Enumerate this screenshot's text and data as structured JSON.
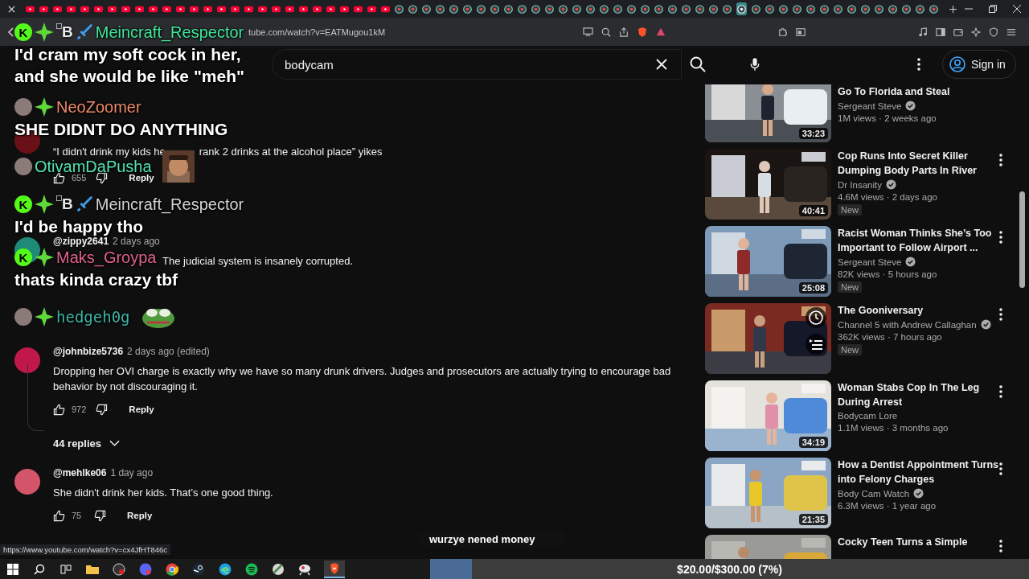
{
  "tabs": [
    {
      "kind": "youtube",
      "selected": false
    },
    {
      "kind": "youtube",
      "selected": false
    },
    {
      "kind": "youtube",
      "selected": false
    },
    {
      "kind": "youtube",
      "selected": false
    },
    {
      "kind": "youtube",
      "selected": false
    },
    {
      "kind": "youtube",
      "selected": false
    },
    {
      "kind": "youtube",
      "selected": false
    },
    {
      "kind": "youtube",
      "selected": false
    },
    {
      "kind": "youtube",
      "selected": false
    },
    {
      "kind": "youtube",
      "selected": false
    },
    {
      "kind": "youtube",
      "selected": false
    },
    {
      "kind": "youtube",
      "selected": false
    },
    {
      "kind": "youtube",
      "selected": false
    },
    {
      "kind": "youtube",
      "selected": false
    },
    {
      "kind": "youtube",
      "selected": false
    },
    {
      "kind": "youtube",
      "selected": false
    },
    {
      "kind": "youtube",
      "selected": false
    },
    {
      "kind": "youtube",
      "selected": false
    },
    {
      "kind": "youtube",
      "selected": false
    },
    {
      "kind": "youtube",
      "selected": false
    },
    {
      "kind": "youtube",
      "selected": false
    },
    {
      "kind": "youtube",
      "selected": false
    },
    {
      "kind": "youtube",
      "selected": false
    },
    {
      "kind": "youtube",
      "selected": false
    },
    {
      "kind": "youtube",
      "selected": false
    },
    {
      "kind": "youtube",
      "selected": false
    },
    {
      "kind": "youtube",
      "selected": false
    },
    {
      "kind": "site",
      "selected": false
    },
    {
      "kind": "site",
      "selected": false
    },
    {
      "kind": "site",
      "selected": false
    },
    {
      "kind": "site",
      "selected": false
    },
    {
      "kind": "site",
      "selected": false
    },
    {
      "kind": "site",
      "selected": false
    },
    {
      "kind": "site",
      "selected": false
    },
    {
      "kind": "site",
      "selected": false
    },
    {
      "kind": "site",
      "selected": false
    },
    {
      "kind": "site",
      "selected": false
    },
    {
      "kind": "site",
      "selected": false
    },
    {
      "kind": "site",
      "selected": false
    },
    {
      "kind": "site",
      "selected": false
    },
    {
      "kind": "site",
      "selected": false
    },
    {
      "kind": "site",
      "selected": false
    },
    {
      "kind": "site",
      "selected": false
    },
    {
      "kind": "site",
      "selected": false
    },
    {
      "kind": "site",
      "selected": false
    },
    {
      "kind": "site",
      "selected": false
    },
    {
      "kind": "site",
      "selected": false
    },
    {
      "kind": "site",
      "selected": false
    },
    {
      "kind": "site",
      "selected": false
    },
    {
      "kind": "site",
      "selected": false
    },
    {
      "kind": "site",
      "selected": false
    },
    {
      "kind": "site",
      "selected": false
    },
    {
      "kind": "site",
      "selected": true
    },
    {
      "kind": "site",
      "selected": false
    },
    {
      "kind": "site",
      "selected": false
    },
    {
      "kind": "site",
      "selected": false
    },
    {
      "kind": "site",
      "selected": false
    },
    {
      "kind": "site",
      "selected": false
    },
    {
      "kind": "site",
      "selected": false
    },
    {
      "kind": "site",
      "selected": false
    },
    {
      "kind": "site",
      "selected": false
    },
    {
      "kind": "site",
      "selected": false
    },
    {
      "kind": "site",
      "selected": false
    },
    {
      "kind": "site",
      "selected": false
    },
    {
      "kind": "site",
      "selected": false
    },
    {
      "kind": "site",
      "selected": false
    },
    {
      "kind": "site",
      "selected": false
    }
  ],
  "browser": {
    "url": "tube.com/watch?v=EATMugou1kM",
    "status_url": "https://www.youtube.com/watch?v=cx4JfHT846c"
  },
  "search": {
    "value": "bodycam"
  },
  "sign_in": "Sign in",
  "comments": [
    {
      "color": "#6a1018",
      "text_parts": [
        "“I didn't drink my kids he",
        "rank 2 drinks at the alcohol place” yikes"
      ],
      "likes": "655",
      "reply": "Reply"
    },
    {
      "color": "#1f8a78",
      "author": "@zippy2641",
      "time": "2 days ago",
      "text_parts": [
        "The judicial system is insanely corrupted."
      ]
    },
    {
      "color": "#c0184a",
      "author": "@johnbize5736",
      "time": "2 days ago (edited)",
      "text_parts": [
        "Dropping her OVI charge is exactly why we have so many drunk drivers. Judges and prosecutors are actually trying to encourage bad behavior by not discouraging it."
      ],
      "likes": "972",
      "reply": "Reply",
      "replies": "44 replies"
    },
    {
      "color": "#d2556a",
      "author": "@mehlke06",
      "time": "1 day ago",
      "text_parts": [
        "She didn't drink her kids. That’s one good thing."
      ],
      "likes": "75",
      "reply": "Reply"
    }
  ],
  "sidebar_videos": [
    {
      "title": "Go To Florida and Steal",
      "channel": "Sergeant Steve",
      "verified": true,
      "meta": "1M views · 2 weeks ago",
      "duration": "33:23",
      "menu": false
    },
    {
      "title": "Cop Runs Into Secret Killer Dumping Body Parts In River",
      "channel": "Dr Insanity",
      "verified": true,
      "meta": "4.6M views · 2 days ago",
      "badge": "New",
      "duration": "40:41",
      "menu": true
    },
    {
      "title": "Racist Woman Thinks She’s Too Important to Follow Airport ...",
      "channel": "Sergeant Steve",
      "verified": true,
      "meta": "82K views · 5 hours ago",
      "badge": "New",
      "duration": "25:08",
      "menu": true
    },
    {
      "title": "The Gooniversary",
      "channel": "Channel 5 with Andrew Callaghan",
      "verified": true,
      "meta": "362K views · 7 hours ago",
      "badge": "New",
      "hover": true,
      "menu": true
    },
    {
      "title": "Woman Stabs Cop In The Leg During Arrest",
      "channel": "Bodycam Lore",
      "verified": false,
      "meta": "1.1M views · 3 months ago",
      "duration": "34:19",
      "menu": true
    },
    {
      "title": "How a Dentist Appointment Turns into Felony Charges",
      "channel": "Body Cam Watch",
      "verified": true,
      "meta": "6.3M views · 1 year ago",
      "duration": "21:35",
      "menu": true
    },
    {
      "title": "Cocky Teen Turns a Simple",
      "menu": true
    }
  ],
  "chat": [
    {
      "name": "Meincraft_Respector",
      "color": "#3ee89a",
      "badges": [
        {
          "kind": "kick",
          "text": "K"
        },
        {
          "kind": "diamond"
        },
        {
          "kind": "alt",
          "text": "B"
        },
        {
          "kind": "sword"
        }
      ],
      "message": "I'd cram my soft cock in her, and she would be like \"meh\""
    },
    {
      "name": "NeoZoomer",
      "color": "#f0896a",
      "badges": [
        {
          "kind": "avatar"
        },
        {
          "kind": "diamond"
        }
      ],
      "message": "SHE DIDNT DO ANYTHING"
    },
    {
      "name": "OtivamDaPusha",
      "color": "#52e3b6",
      "badges": [
        {
          "kind": "avatar"
        }
      ],
      "kind": "picture-emote"
    },
    {
      "name": "Meincraft_Respector",
      "color": "#d4d4d4",
      "badges": [
        {
          "kind": "kick",
          "text": "K"
        },
        {
          "kind": "diamond"
        },
        {
          "kind": "alt",
          "text": "B"
        },
        {
          "kind": "sword"
        }
      ],
      "message": "I'd be happy tho"
    },
    {
      "name": "Maks_Groypa",
      "color": "#e2628c",
      "badges": [
        {
          "kind": "kick",
          "text": "K"
        },
        {
          "kind": "diamond"
        }
      ],
      "message": "thats kinda crazy tbf"
    },
    {
      "name": "hedgeh0g",
      "color": "#3bb5a4",
      "badges": [
        {
          "kind": "avatar"
        },
        {
          "kind": "diamond"
        }
      ],
      "kind": "frog-emote"
    }
  ],
  "goal": {
    "title": "wurzye nened money",
    "amount": "$20.00/$300.00 (7%)",
    "level": 0.07
  },
  "taskbar": [
    {
      "kind": "windows",
      "selected": false
    },
    {
      "kind": "search",
      "selected": false
    },
    {
      "kind": "taskview",
      "selected": false
    },
    {
      "kind": "folder",
      "selected": false
    },
    {
      "kind": "record",
      "selected": false
    },
    {
      "kind": "chat",
      "selected": false
    },
    {
      "kind": "chrome",
      "selected": false
    },
    {
      "kind": "steam",
      "selected": false
    },
    {
      "kind": "edge",
      "selected": false
    },
    {
      "kind": "spotify",
      "selected": false
    },
    {
      "kind": "app",
      "selected": false
    },
    {
      "kind": "app2",
      "selected": false
    },
    {
      "kind": "brave",
      "selected": true
    }
  ]
}
